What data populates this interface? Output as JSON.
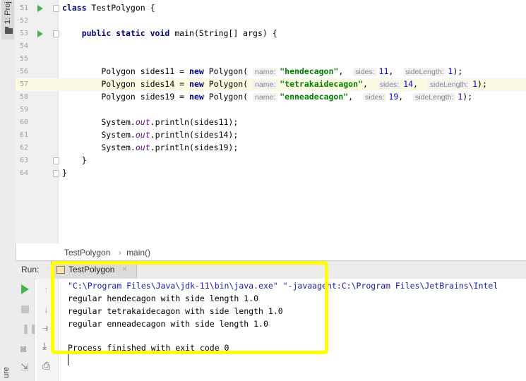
{
  "sidebar": {
    "project_label": "1: Proj",
    "bottom_label": "ure"
  },
  "editor": {
    "lines": [
      {
        "num": "51",
        "html": "<span class=\"kw\">class</span> TestPolygon {",
        "run": true,
        "fold": true,
        "hl": false
      },
      {
        "num": "52",
        "html": "",
        "run": false,
        "fold": false,
        "hl": false
      },
      {
        "num": "53",
        "html": "    <span class=\"kw\">public static void</span> main(String[] args) {",
        "run": true,
        "fold": true,
        "hl": false
      },
      {
        "num": "54",
        "html": "",
        "run": false,
        "fold": false,
        "hl": false
      },
      {
        "num": "55",
        "html": "",
        "run": false,
        "fold": false,
        "hl": false
      },
      {
        "num": "56",
        "html": "        Polygon sides11 = <span class=\"kw\">new</span> Polygon( <span class=\"hint\">name:</span><span class=\"str\">\"hendecagon\"</span>,  <span class=\"hint\">sides:</span><span class=\"num\">11</span>,  <span class=\"hint\">sideLength:</span><span class=\"num\">1</span>);",
        "run": false,
        "fold": false,
        "hl": false
      },
      {
        "num": "57",
        "html": "        Polygon sides14 = <span class=\"kw\">new</span> Polygon( <span class=\"hint\">name:</span><span class=\"str\">\"tetrakaidecagon\"</span>,  <span class=\"hint\">sides:</span><span class=\"num\">14</span>,  <span class=\"hint\">sideLength:</span><span class=\"num\">1</span>);",
        "run": false,
        "fold": false,
        "hl": true
      },
      {
        "num": "58",
        "html": "        Polygon sides19 = <span class=\"kw\">new</span> Polygon( <span class=\"hint\">name:</span><span class=\"str\">\"enneadecagon\"</span>,  <span class=\"hint\">sides:</span><span class=\"num\">19</span>,  <span class=\"hint\">sideLength:</span><span class=\"num\">1</span>);",
        "run": false,
        "fold": false,
        "hl": false
      },
      {
        "num": "59",
        "html": "",
        "run": false,
        "fold": false,
        "hl": false
      },
      {
        "num": "60",
        "html": "        System.<span class=\"fld\">out</span>.println(sides11);",
        "run": false,
        "fold": false,
        "hl": false
      },
      {
        "num": "61",
        "html": "        System.<span class=\"fld\">out</span>.println(sides14);",
        "run": false,
        "fold": false,
        "hl": false
      },
      {
        "num": "62",
        "html": "        System.<span class=\"fld\">out</span>.println(sides19);",
        "run": false,
        "fold": false,
        "hl": false
      },
      {
        "num": "63",
        "html": "    }",
        "run": false,
        "fold": true,
        "hl": false
      },
      {
        "num": "64",
        "html": "}",
        "run": false,
        "fold": true,
        "hl": false
      }
    ]
  },
  "breadcrumb": {
    "class_name": "TestPolygon",
    "separator": "›",
    "method_name": "main()"
  },
  "run_panel": {
    "title": "Run:",
    "tab_label": "TestPolygon",
    "tab_close": "×",
    "console_lines": [
      "\"C:\\Program Files\\Java\\jdk-11\\bin\\java.exe\" \"-javaagent:C:\\Program Files\\JetBrains\\Intel",
      "regular hendecagon with side length 1.0",
      "regular tetrakaidecagon with side length 1.0",
      "regular enneadecagon with side length 1.0",
      "",
      "Process finished with exit code 0"
    ]
  },
  "colors": {
    "highlight": "#ffff00",
    "keyword": "#000080",
    "string": "#008000",
    "number": "#0000ff",
    "run_green": "#4caf50"
  }
}
